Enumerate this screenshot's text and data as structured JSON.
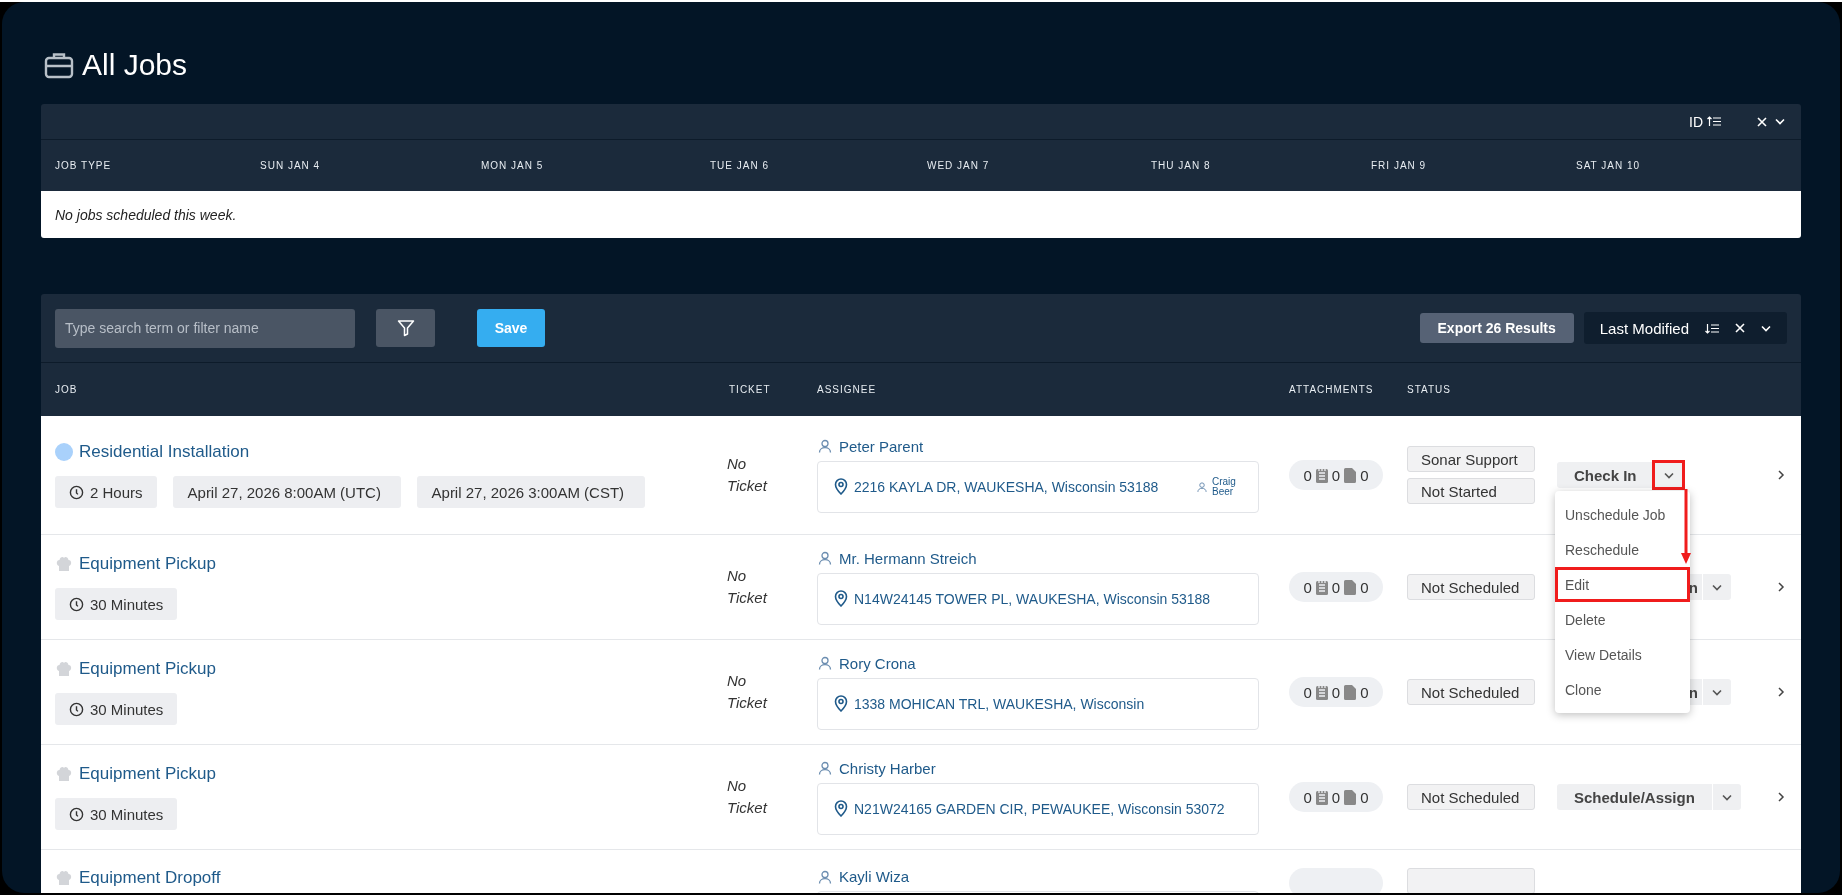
{
  "page": {
    "title": "All Jobs"
  },
  "calendar": {
    "sort_label": "ID",
    "columns": [
      "JOB TYPE",
      "SUN JAN 4",
      "MON JAN 5",
      "TUE JAN 6",
      "WED JAN 7",
      "THU JAN 8",
      "FRI JAN 9",
      "SAT JAN 10"
    ],
    "empty_message": "No jobs scheduled this week."
  },
  "jobs": {
    "search": {
      "placeholder": "Type search term or filter name"
    },
    "save_label": "Save",
    "export_label": "Export 26 Results",
    "sort_label": "Last Modified",
    "columns": [
      "JOB",
      "TICKET",
      "ASSIGNEE",
      "ATTACHMENTS",
      "STATUS"
    ],
    "rows": [
      {
        "kind": "dot",
        "color": "#a9d1fb",
        "title": "Residential Installation",
        "duration": "2 Hours",
        "dates": [
          "April 27, 2026 8:00AM (UTC)",
          "April 27, 2026 3:00AM (CST)"
        ],
        "ticket": "No Ticket",
        "assignee": "Peter Parent",
        "address": "2216 KAYLA DR, WAUKESHA, Wisconsin 53188",
        "sub_assignee": "Craig Beer",
        "attachments": [
          "0",
          "0",
          "0"
        ],
        "statuses": [
          "Sonar Support",
          "Not Started"
        ],
        "action": "Check In",
        "covered": false,
        "caret_annotated": true
      },
      {
        "kind": "hat",
        "title": "Equipment Pickup",
        "duration": "30 Minutes",
        "ticket": "No Ticket",
        "assignee": "Mr. Hermann Streich",
        "address": "N14W24145 TOWER PL, WAUKESHA, Wisconsin 53188",
        "attachments": [
          "0",
          "0",
          "0"
        ],
        "statuses": [
          "Not Scheduled"
        ],
        "action": "n",
        "covered": true,
        "caret_annotated": false
      },
      {
        "kind": "hat",
        "title": "Equipment Pickup",
        "duration": "30 Minutes",
        "ticket": "No Ticket",
        "assignee": "Rory Crona",
        "address": "1338 MOHICAN TRL, WAUKESHA, Wisconsin",
        "attachments": [
          "0",
          "0",
          "0"
        ],
        "statuses": [
          "Not Scheduled"
        ],
        "action": "n",
        "covered": true,
        "caret_annotated": false
      },
      {
        "kind": "hat",
        "title": "Equipment Pickup",
        "duration": "30 Minutes",
        "ticket": "No Ticket",
        "assignee": "Christy Harber",
        "address": "N21W24165 GARDEN CIR, PEWAUKEE, Wisconsin 53072",
        "attachments": [
          "0",
          "0",
          "0"
        ],
        "statuses": [
          "Not Scheduled"
        ],
        "action": "Schedule/Assign",
        "covered": false,
        "caret_annotated": false
      },
      {
        "kind": "hat",
        "title": "Equipment Dropoff",
        "assignee": "Kayli Wiza"
      }
    ]
  },
  "menu": {
    "items": [
      {
        "label": "Unschedule Job",
        "annotated": false
      },
      {
        "label": "Reschedule",
        "annotated": false
      },
      {
        "label": "Edit",
        "annotated": true
      },
      {
        "label": "Delete",
        "annotated": false
      },
      {
        "label": "View Details",
        "annotated": false
      },
      {
        "label": "Clone",
        "annotated": false
      }
    ]
  }
}
